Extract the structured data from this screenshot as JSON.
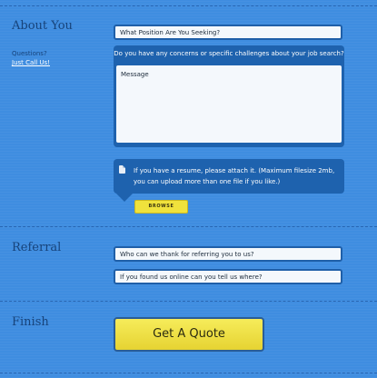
{
  "sections": {
    "about": "About You",
    "referral": "Referral",
    "finish": "Finish"
  },
  "sidebar": {
    "questions": "Questions?",
    "call_link": "Just Call Us!"
  },
  "fields": {
    "position_placeholder": "What Position Are You Seeking?",
    "concerns_prompt": "Do you have any concerns or specific challenges about your job search?",
    "message_placeholder": "Message",
    "referrer_placeholder": "Who can we thank for referring you to us?",
    "found_online_placeholder": "If you found us online can you tell us where?"
  },
  "resume": {
    "text": "If you have a resume, please attach it. (Maximum filesize 2mb, you can upload more than one file if you like.)",
    "browse_label": "BROWSE",
    "icon": "document-icon"
  },
  "submit": {
    "label": "Get A Quote"
  },
  "colors": {
    "background": "#3f8de0",
    "panel": "#1e62ae",
    "accent_yellow": "#f0e23c",
    "heading": "#17437a"
  }
}
